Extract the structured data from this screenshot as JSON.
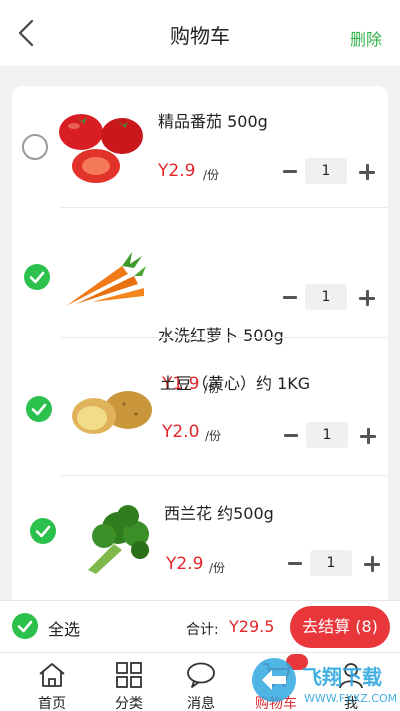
{
  "header": {
    "title": "购物车",
    "delete_label": "删除"
  },
  "cart": {
    "items": [
      {
        "name": "精品番茄  500g",
        "price": "Y2.9",
        "unit": "/份",
        "qty": "1",
        "checked": false,
        "icon": "tomato-image"
      },
      {
        "name": "水洗红萝卜 500g",
        "price": "Y1.9",
        "unit": "/份",
        "qty": "1",
        "checked": true,
        "icon": "carrot-image"
      },
      {
        "name": "土豆（黄心）约 1KG",
        "price": "Y2.0",
        "unit": "/份",
        "qty": "1",
        "checked": true,
        "icon": "potato-image"
      },
      {
        "name": "西兰花 约500g",
        "price": "Y2.9",
        "unit": "/份",
        "qty": "1",
        "checked": true,
        "icon": "broccoli-image"
      }
    ]
  },
  "footer": {
    "select_all_label": "全选",
    "total_label": "合计:",
    "total_value": "Y29.5",
    "checkout_label": "去结算 (8)"
  },
  "tabbar": {
    "tabs": [
      {
        "label": "首页",
        "icon": "home-icon"
      },
      {
        "label": "分类",
        "icon": "grid-icon"
      },
      {
        "label": "消息",
        "icon": "chat-icon"
      },
      {
        "label": "购物车",
        "icon": "cart-icon",
        "active": true
      },
      {
        "label": "我",
        "icon": "user-icon"
      }
    ]
  },
  "watermark": {
    "text": "飞翔下载",
    "url": "WWW.FXXZ.COM"
  },
  "colors": {
    "accent_green": "#2cc04c",
    "price_red": "#e0272b",
    "checkout_red": "#e8363a"
  }
}
